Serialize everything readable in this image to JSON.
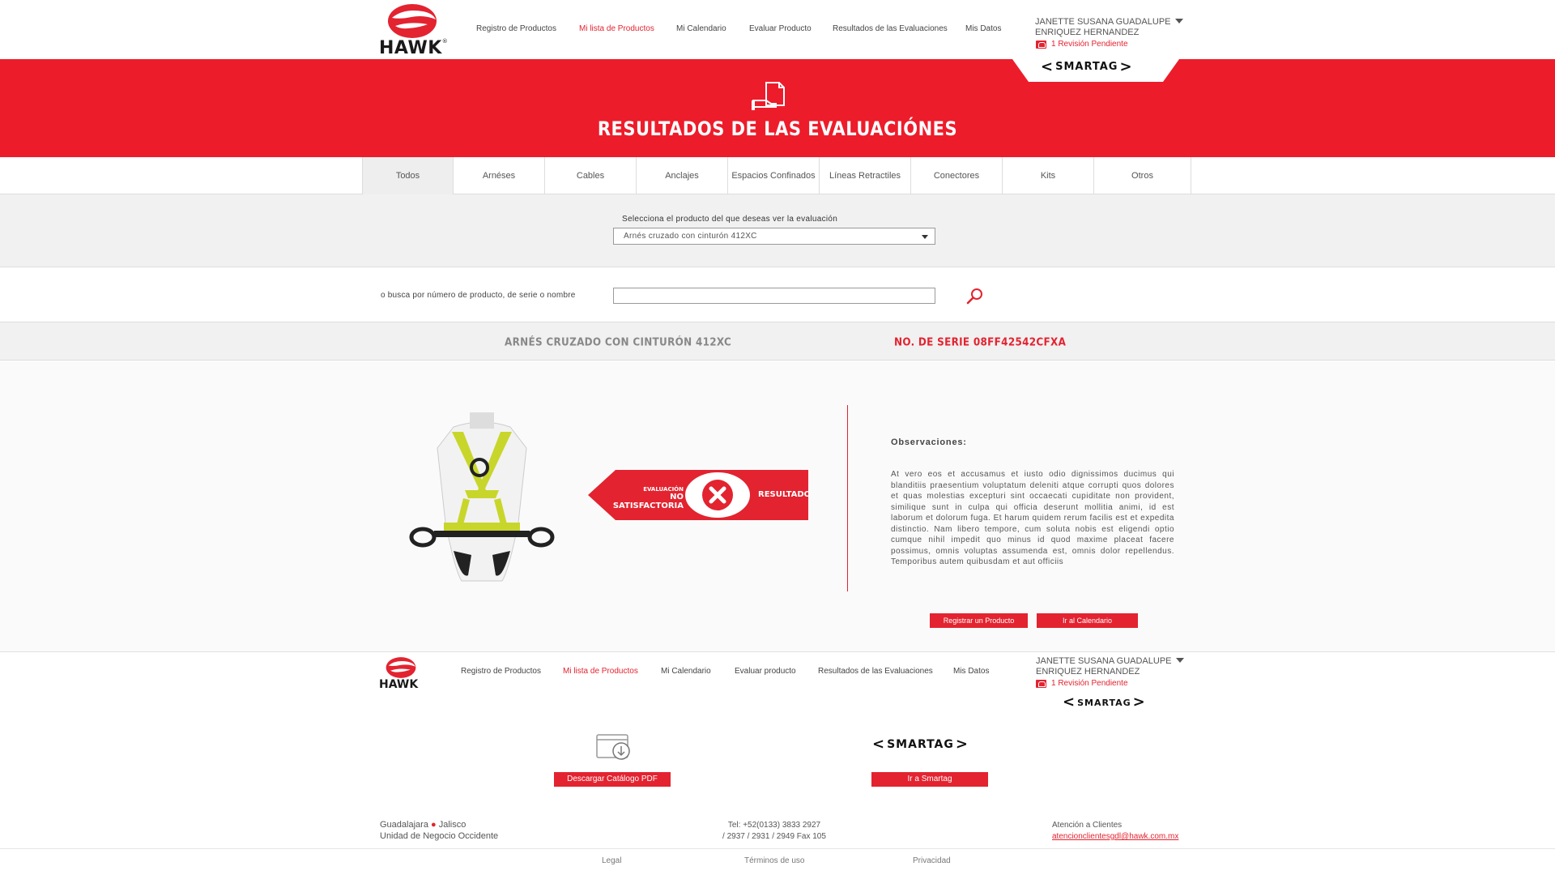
{
  "header": {
    "brand": "HAWK",
    "nav": [
      {
        "label": "Registro de Productos"
      },
      {
        "label": "Mi lista de Productos"
      },
      {
        "label": "Mi Calendario"
      },
      {
        "label": "Evaluar Producto"
      },
      {
        "label": "Resultados de las Evaluaciones"
      },
      {
        "label": "Mis Datos"
      }
    ],
    "active_nav": "Mi lista de Productos",
    "user_name_line1": "JANETTE SUSANA GUADALUPE",
    "user_name_line2": "ENRIQUEZ HERNANDEZ",
    "pending": "1 Revisión Pendiente",
    "smartag": "SMARTAG"
  },
  "banner": {
    "title": "RESULTADOS DE LAS EVALUACIÓNES",
    "icon": "document-hand-icon"
  },
  "tabs": [
    {
      "label": "Todos",
      "active": true
    },
    {
      "label": "Arnéses"
    },
    {
      "label": "Cables"
    },
    {
      "label": "Anclajes"
    },
    {
      "label": "Espacios Confinados"
    },
    {
      "label": "Líneas Retractiles"
    },
    {
      "label": "Conectores"
    },
    {
      "label": "Kits"
    },
    {
      "label": "Otros"
    }
  ],
  "selector": {
    "label": "Selecciona el producto del que deseas ver la evaluación",
    "value": "Arnés cruzado con cinturón 412XC"
  },
  "search": {
    "label": "o busca por número de producto, de serie o nombre",
    "value": ""
  },
  "product": {
    "name": "ARNÉS CRUZADO CON CINTURÓN 412XC",
    "serial": "NO. DE SERIE 08FF42542CFXA"
  },
  "result": {
    "eval_line1": "EVALUACIÓN",
    "eval_line2": "NO SATISFACTORIA",
    "label": "RESULTADO",
    "status_icon": "x-circle-icon",
    "observations_title": "Observaciones:",
    "observations": "At vero eos et accusamus et iusto odio dignissimos ducimus qui blanditiis praesentium voluptatum deleniti atque corrupti quos dolores et quas molestias excepturi sint occaecati cupiditate non provident, similique sunt in culpa qui officia deserunt mollitia animi, id est laborum et dolorum fuga. Et harum quidem rerum facilis est et expedita distinctio. Nam libero tempore, cum soluta nobis est eligendi optio cumque nihil impedit quo minus id quod maxime placeat facere possimus, omnis voluptas assumenda est, omnis dolor repellendus. Temporibus autem quibusdam et aut officiis",
    "btn_register": "Registrar un Producto",
    "btn_calendar": "Ir al Calendario"
  },
  "footer": {
    "nav": [
      {
        "label": "Registro de Productos"
      },
      {
        "label": "Mi lista de Productos"
      },
      {
        "label": "Mi Calendario"
      },
      {
        "label": "Evaluar producto"
      },
      {
        "label": "Resultados de las Evaluaciones"
      },
      {
        "label": "Mis Datos"
      }
    ],
    "user_name_line1": "JANETTE SUSANA GUADALUPE",
    "user_name_line2": "ENRIQUEZ HERNANDEZ",
    "pending": "1 Revisión Pendiente",
    "smartag": "SMARTAG",
    "catalog_btn": "Descargar Catálogo PDF",
    "smartag_btn": "Ir a Smartag",
    "city": "Guadalajara",
    "state": "Jalisco",
    "unit": "Unidad de Negocio Occidente",
    "tel_line1": "Tel: +52(0133) 3833 2927",
    "tel_line2": "/ 2937 / 2931 / 2949 Fax 105",
    "attention": "Atención a Clientes",
    "email": "atencionclientesgdl@hawk.com.mx",
    "legal": "Legal",
    "terms": "Términos de uso",
    "privacy": "Privacidad"
  },
  "colors": {
    "accent": "#ed1c2b",
    "harness": "#c8d62b"
  }
}
